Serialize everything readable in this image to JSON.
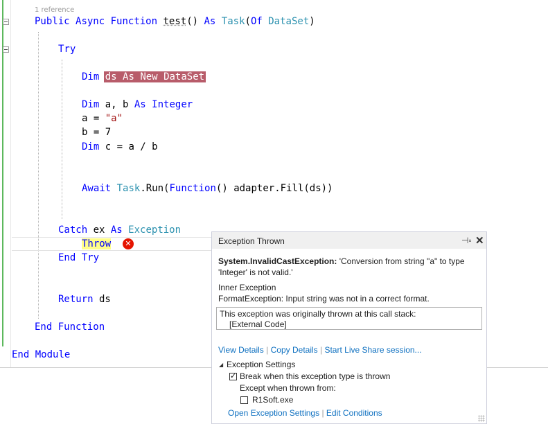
{
  "editor": {
    "codelens": "1 reference",
    "lines": {
      "l1": {
        "k1": "Public",
        "k2": "Async",
        "k3": "Function",
        "name": "test",
        "paren": "() ",
        "k4": "As",
        "t1": "Task",
        "p2": "(",
        "k5": "Of",
        "t2": "DataSet",
        "p3": ")"
      },
      "l2": {
        "k1": "Try"
      },
      "l3": {
        "k1": "Dim",
        "hl_text": "ds",
        "hl_k1": "As",
        "hl_k2": "New",
        "hl_t": "DataSet"
      },
      "l4": {
        "k1": "Dim",
        "rest": " a, b ",
        "k2": "As",
        "k3": "Integer"
      },
      "l5": {
        "pre": "a = ",
        "str": "\"a\""
      },
      "l6": {
        "text": "b = 7"
      },
      "l7": {
        "k1": "Dim",
        "rest": " c = a / b"
      },
      "l8": {
        "k1": "Await",
        "t1": "Task",
        "dot": ".Run(",
        "k2": "Function",
        "rest": "() adapter.Fill(ds))"
      },
      "l9": {
        "k1": "Catch",
        "rest": " ex ",
        "k2": "As",
        "t1": "Exception"
      },
      "l10": {
        "k1": "Throw"
      },
      "l11": {
        "k1": "End",
        "k2": "Try"
      },
      "l12": {
        "k1": "Return",
        "rest": " ds"
      },
      "l13": {
        "k1": "End",
        "k2": "Function"
      },
      "l14": {
        "k1": "End",
        "k2": "Module"
      }
    }
  },
  "popup": {
    "title": "Exception Thrown",
    "pin_icon": "pin-icon",
    "close_icon": "close-icon",
    "exception_type": "System.InvalidCastException:",
    "message_line1": " 'Conversion from string \"a\" to type",
    "message_line2": "'Integer' is not valid.'",
    "inner_heading": "Inner Exception",
    "inner_message": "FormatException: Input string was not in a correct format.",
    "stack_heading": "This exception was originally thrown at this call stack:",
    "stack_item": "[External Code]",
    "links": [
      "View Details",
      "Copy Details",
      "Start Live Share session..."
    ],
    "settings_heading": "Exception Settings",
    "break_label": "Break when this exception type is thrown",
    "break_checked": true,
    "except_label": "Except when thrown from:",
    "module_label": "R1Soft.exe",
    "module_checked": false,
    "bottom_links": [
      "Open Exception Settings",
      "Edit Conditions"
    ]
  },
  "colors": {
    "keyword": "#0000ff",
    "type": "#2b91af",
    "string": "#a31515",
    "link": "#0e70c0",
    "error": "#e51400",
    "highlight": "#b85c6a"
  }
}
